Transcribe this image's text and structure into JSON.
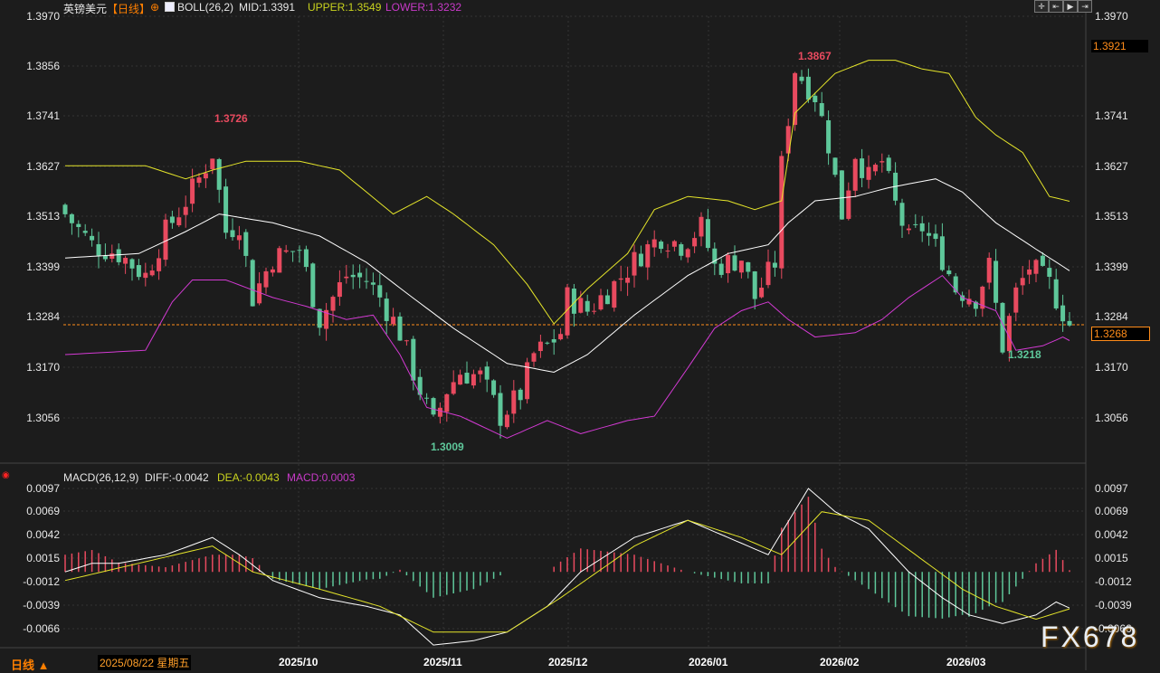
{
  "header": {
    "symbol": "英镑美元",
    "period": "【日线】",
    "indicator": "BOLL(26,2)",
    "mid": "MID:1.3391",
    "upper": "UPPER:1.3549",
    "lower": "LOWER:1.3232"
  },
  "macd_header": {
    "name": "MACD(26,12,9)",
    "diff": "DIFF:-0.0042",
    "dea": "DEA:-0.0043",
    "macd": "MACD:0.0003"
  },
  "price_axis": [
    "1.3970",
    "1.3856",
    "1.3741",
    "1.3627",
    "1.3513",
    "1.3399",
    "1.3284",
    "1.3170",
    "1.3056"
  ],
  "macd_axis": [
    "0.0097",
    "0.0069",
    "0.0042",
    "0.0015",
    "-0.0012",
    "-0.0039",
    "-0.0066"
  ],
  "price_marker": "1.3921",
  "last_price": "1.3268",
  "x_axis": [
    "2025/10",
    "2025/11",
    "2025/12",
    "2026/01",
    "2026/02",
    "2026/03"
  ],
  "footer": {
    "period_button": "日线 ▲",
    "cursor_date": "2025/08/22 星期五"
  },
  "annotations": {
    "high1": "1.3726",
    "high2": "1.3867",
    "low1": "1.3009",
    "low2": "1.3218"
  },
  "watermark": "FX678",
  "toolbar": [
    "crosshair",
    "zoom-in",
    "zoom-out",
    "scroll-end"
  ],
  "colors": {
    "up": "#e84a5f",
    "down": "#5ec79a",
    "upper": "#e5e52a",
    "mid": "#ffffff",
    "lower": "#d33ad3",
    "dea": "#e5e52a",
    "accent": "#ff7f00"
  },
  "chart_data": {
    "type": "candlestick",
    "bars": 151,
    "close": [
      [
        0,
        1.352
      ],
      [
        4,
        1.345
      ],
      [
        8,
        1.343
      ],
      [
        12,
        1.338
      ],
      [
        15,
        1.348
      ],
      [
        18,
        1.355
      ],
      [
        20,
        1.36
      ],
      [
        22,
        1.366
      ],
      [
        24,
        1.348
      ],
      [
        26,
        1.35
      ],
      [
        28,
        1.333
      ],
      [
        31,
        1.342
      ],
      [
        35,
        1.344
      ],
      [
        38,
        1.328
      ],
      [
        42,
        1.338
      ],
      [
        45,
        1.337
      ],
      [
        47,
        1.333
      ],
      [
        50,
        1.325
      ],
      [
        52,
        1.316
      ],
      [
        55,
        1.304
      ],
      [
        57,
        1.312
      ],
      [
        59,
        1.316
      ],
      [
        62,
        1.315
      ],
      [
        65,
        1.306
      ],
      [
        68,
        1.311
      ],
      [
        70,
        1.32
      ],
      [
        72,
        1.322
      ],
      [
        74,
        1.325
      ],
      [
        75,
        1.333
      ],
      [
        78,
        1.33
      ],
      [
        82,
        1.336
      ],
      [
        86,
        1.343
      ],
      [
        89,
        1.347
      ],
      [
        92,
        1.345
      ],
      [
        95,
        1.349
      ],
      [
        97,
        1.34
      ],
      [
        101,
        1.342
      ],
      [
        103,
        1.333
      ],
      [
        106,
        1.341
      ],
      [
        107,
        1.363
      ],
      [
        109,
        1.385
      ],
      [
        112,
        1.379
      ],
      [
        114,
        1.368
      ],
      [
        116,
        1.352
      ],
      [
        118,
        1.366
      ],
      [
        120,
        1.36
      ],
      [
        122,
        1.364
      ],
      [
        124,
        1.354
      ],
      [
        126,
        1.346
      ],
      [
        128,
        1.349
      ],
      [
        131,
        1.342
      ],
      [
        133,
        1.335
      ],
      [
        136,
        1.333
      ],
      [
        138,
        1.34
      ],
      [
        140,
        1.322
      ],
      [
        142,
        1.334
      ],
      [
        144,
        1.34
      ],
      [
        147,
        1.336
      ],
      [
        150,
        1.3268
      ]
    ],
    "boll_upper": [
      [
        0,
        1.363
      ],
      [
        7,
        1.363
      ],
      [
        12,
        1.363
      ],
      [
        18,
        1.36
      ],
      [
        22,
        1.362
      ],
      [
        27,
        1.364
      ],
      [
        35,
        1.364
      ],
      [
        41,
        1.362
      ],
      [
        45,
        1.357
      ],
      [
        49,
        1.352
      ],
      [
        54,
        1.356
      ],
      [
        58,
        1.352
      ],
      [
        64,
        1.345
      ],
      [
        69,
        1.336
      ],
      [
        73,
        1.327
      ],
      [
        78,
        1.335
      ],
      [
        84,
        1.343
      ],
      [
        88,
        1.353
      ],
      [
        93,
        1.356
      ],
      [
        99,
        1.355
      ],
      [
        103,
        1.353
      ],
      [
        107,
        1.355
      ],
      [
        109,
        1.375
      ],
      [
        115,
        1.384
      ],
      [
        120,
        1.387
      ],
      [
        124,
        1.387
      ],
      [
        128,
        1.385
      ],
      [
        132,
        1.384
      ],
      [
        136,
        1.374
      ],
      [
        139,
        1.37
      ],
      [
        143,
        1.366
      ],
      [
        147,
        1.356
      ],
      [
        150,
        1.3549
      ]
    ],
    "boll_mid": [
      [
        0,
        1.342
      ],
      [
        11,
        1.343
      ],
      [
        18,
        1.348
      ],
      [
        23,
        1.352
      ],
      [
        31,
        1.35
      ],
      [
        38,
        1.347
      ],
      [
        45,
        1.341
      ],
      [
        51,
        1.334
      ],
      [
        58,
        1.326
      ],
      [
        66,
        1.318
      ],
      [
        73,
        1.316
      ],
      [
        78,
        1.32
      ],
      [
        85,
        1.329
      ],
      [
        93,
        1.338
      ],
      [
        99,
        1.343
      ],
      [
        105,
        1.345
      ],
      [
        108,
        1.35
      ],
      [
        112,
        1.355
      ],
      [
        118,
        1.356
      ],
      [
        123,
        1.358
      ],
      [
        130,
        1.36
      ],
      [
        134,
        1.357
      ],
      [
        139,
        1.35
      ],
      [
        145,
        1.344
      ],
      [
        150,
        1.3391
      ]
    ],
    "boll_lower": [
      [
        0,
        1.32
      ],
      [
        12,
        1.321
      ],
      [
        16,
        1.332
      ],
      [
        19,
        1.337
      ],
      [
        24,
        1.337
      ],
      [
        31,
        1.333
      ],
      [
        36,
        1.331
      ],
      [
        42,
        1.328
      ],
      [
        46,
        1.329
      ],
      [
        50,
        1.32
      ],
      [
        54,
        1.308
      ],
      [
        59,
        1.306
      ],
      [
        66,
        1.301
      ],
      [
        72,
        1.305
      ],
      [
        77,
        1.302
      ],
      [
        84,
        1.305
      ],
      [
        88,
        1.306
      ],
      [
        93,
        1.317
      ],
      [
        97,
        1.326
      ],
      [
        101,
        1.33
      ],
      [
        105,
        1.332
      ],
      [
        108,
        1.328
      ],
      [
        112,
        1.324
      ],
      [
        118,
        1.325
      ],
      [
        122,
        1.328
      ],
      [
        126,
        1.333
      ],
      [
        131,
        1.338
      ],
      [
        134,
        1.333
      ],
      [
        139,
        1.33
      ],
      [
        142,
        1.321
      ],
      [
        146,
        1.322
      ],
      [
        149,
        1.324
      ],
      [
        150,
        1.3232
      ]
    ],
    "diff": [
      [
        0,
        0.0
      ],
      [
        4,
        0.001
      ],
      [
        8,
        0.001
      ],
      [
        15,
        0.002
      ],
      [
        22,
        0.004
      ],
      [
        26,
        0.002
      ],
      [
        31,
        -0.001
      ],
      [
        38,
        -0.003
      ],
      [
        45,
        -0.004
      ],
      [
        50,
        -0.005
      ],
      [
        55,
        -0.0085
      ],
      [
        61,
        -0.008
      ],
      [
        66,
        -0.007
      ],
      [
        72,
        -0.004
      ],
      [
        77,
        0.0
      ],
      [
        85,
        0.004
      ],
      [
        93,
        0.006
      ],
      [
        99,
        0.004
      ],
      [
        105,
        0.002
      ],
      [
        111,
        0.0097
      ],
      [
        115,
        0.007
      ],
      [
        120,
        0.005
      ],
      [
        126,
        0.0
      ],
      [
        131,
        -0.003
      ],
      [
        135,
        -0.005
      ],
      [
        140,
        -0.006
      ],
      [
        145,
        -0.005
      ],
      [
        148,
        -0.0035
      ],
      [
        150,
        -0.0042
      ]
    ],
    "dea": [
      [
        0,
        -0.001
      ],
      [
        11,
        0.001
      ],
      [
        22,
        0.003
      ],
      [
        28,
        0.0
      ],
      [
        38,
        -0.002
      ],
      [
        47,
        -0.004
      ],
      [
        55,
        -0.007
      ],
      [
        66,
        -0.007
      ],
      [
        74,
        -0.003
      ],
      [
        85,
        0.003
      ],
      [
        93,
        0.006
      ],
      [
        101,
        0.004
      ],
      [
        107,
        0.002
      ],
      [
        113,
        0.007
      ],
      [
        120,
        0.006
      ],
      [
        127,
        0.002
      ],
      [
        134,
        -0.002
      ],
      [
        139,
        -0.004
      ],
      [
        145,
        -0.0055
      ],
      [
        150,
        -0.0043
      ]
    ],
    "price_range": [
      1.397,
      1.3056
    ],
    "macd_range": [
      0.0097,
      -0.0066
    ]
  }
}
